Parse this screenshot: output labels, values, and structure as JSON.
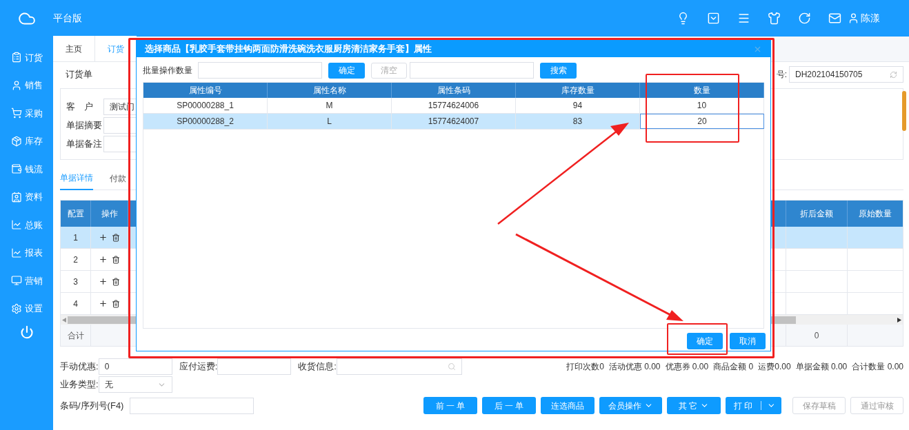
{
  "app": {
    "title": "平台版",
    "user": "陈漾"
  },
  "sidebar": {
    "items": [
      {
        "label": "订货"
      },
      {
        "label": "销售"
      },
      {
        "label": "采购"
      },
      {
        "label": "库存"
      },
      {
        "label": "钱流"
      },
      {
        "label": "资料"
      },
      {
        "label": "总账"
      },
      {
        "label": "报表"
      },
      {
        "label": "营销"
      },
      {
        "label": "设置"
      }
    ]
  },
  "page_tabs": [
    {
      "label": "主页",
      "selected": false
    },
    {
      "label": "订货",
      "selected": true
    }
  ],
  "form": {
    "title": "订货单",
    "doc_no_label": "号:",
    "doc_no": "DH202104150705",
    "fields": [
      {
        "label": "客　户",
        "value": "测试门"
      },
      {
        "label": "单据摘要"
      },
      {
        "label": "单据备注"
      }
    ]
  },
  "detail_tabs": [
    {
      "label": "单据详情",
      "selected": true
    },
    {
      "label": "付款",
      "selected": false
    }
  ],
  "grid": {
    "columns_left": [
      "配置",
      "操作"
    ],
    "columns_right": [
      "折后金额",
      "原始数量"
    ],
    "rows": [
      {
        "index": "1",
        "selected": true
      },
      {
        "index": "2",
        "selected": false
      },
      {
        "index": "3",
        "selected": false
      },
      {
        "index": "4",
        "selected": false
      }
    ],
    "total_label": "合计",
    "total_value": "0"
  },
  "footer": {
    "discount_label": "手动优惠:",
    "discount_value": "0",
    "freight_label": "应付运费:",
    "shipping_label": "收货信息:",
    "business_type_label": "业务类型:",
    "business_type": "无",
    "summary": [
      "打印次数0",
      "活动优惠 0.00",
      "优惠券 0.00",
      "商品金额 0",
      "运费0.00",
      "单据金额 0.00",
      "合计数量 0.00"
    ],
    "barcode_label": "条码/序列号(F4)",
    "buttons": [
      {
        "label": "前 一 单",
        "kind": "primary"
      },
      {
        "label": "后 一 单",
        "kind": "primary"
      },
      {
        "label": "连选商品",
        "kind": "primary"
      },
      {
        "label": "会员操作",
        "kind": "dropdown"
      },
      {
        "label": "其 它",
        "kind": "dropdown"
      },
      {
        "label": "打 印",
        "kind": "split"
      },
      {
        "label": "保存草稿",
        "kind": "outline"
      },
      {
        "label": "通过审核",
        "kind": "outline"
      }
    ]
  },
  "dialog": {
    "title": "选择商品【乳胶手套带挂钩两面防滑洗碗洗衣服厨房清洁家务手套】属性",
    "batch_label": "批量操作数量",
    "confirm": "确定",
    "clear": {
      "label": "清空",
      "disabled": true
    },
    "search": "搜索",
    "columns": [
      "属性编号",
      "属性名称",
      "属性条码",
      "库存数量",
      "数量"
    ],
    "rows": [
      {
        "cells": [
          "SP00000288_1",
          "M",
          "15774624006",
          "94",
          "10"
        ],
        "selected": false
      },
      {
        "cells": [
          "SP00000288_2",
          "L",
          "15774624007",
          "83",
          "20"
        ],
        "selected": true
      }
    ],
    "buttons": [
      "确定",
      "取消"
    ]
  }
}
